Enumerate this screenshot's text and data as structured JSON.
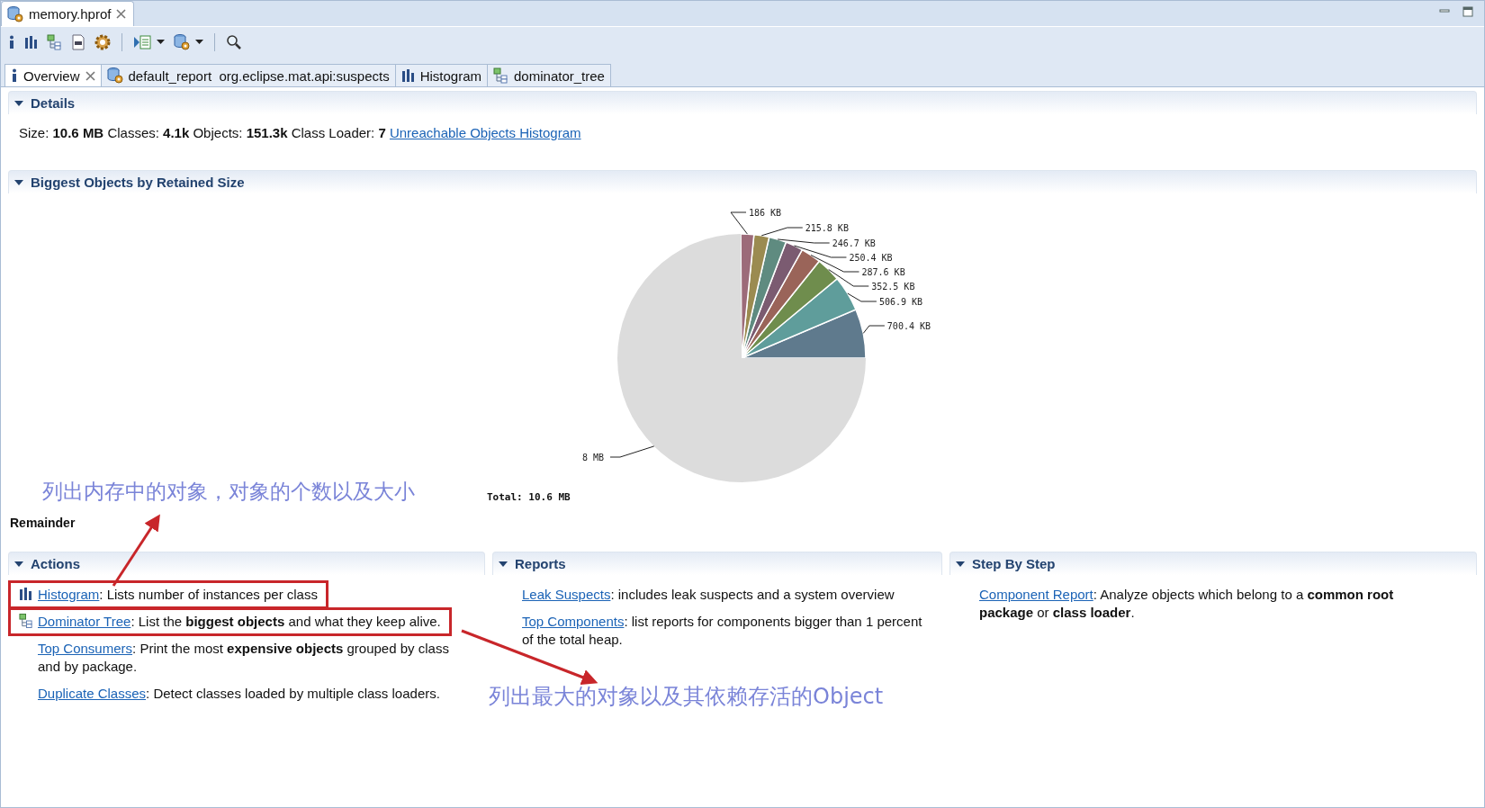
{
  "editor_tab": {
    "title": "memory.hprof",
    "selected": true,
    "closable": true
  },
  "tabs": [
    {
      "kind": "info",
      "label": "Overview",
      "selected": true,
      "closable": true
    },
    {
      "kind": "report",
      "label": "default_report  org.eclipse.mat.api:suspects",
      "selected": false,
      "closable": false
    },
    {
      "kind": "histogram",
      "label": "Histogram",
      "selected": false,
      "closable": false
    },
    {
      "kind": "tree",
      "label": "dominator_tree",
      "selected": false,
      "closable": false
    }
  ],
  "details": {
    "title": "Details",
    "expanded": true,
    "text": "Size: **10.6 MB** Classes: **4.1k** Objects: **151.3k** Class Loader: **7**",
    "link": "Unreachable Objects Histogram"
  },
  "biggest_objects": {
    "title": "Biggest Objects by Retained Size",
    "expanded": true,
    "chart_data": {
      "type": "pie",
      "categories": [
        "700.4 KB",
        "506.9 KB",
        "352.5 KB",
        "287.6 KB",
        "250.4 KB",
        "246.7 KB",
        "215.8 KB",
        "186 KB",
        "8 MB"
      ],
      "values": [
        700.4,
        506.9,
        352.5,
        287.6,
        250.4,
        246.7,
        215.8,
        186,
        8192
      ]
    },
    "total": "Total: 10.6 MB",
    "remainder_label": "Remainder"
  },
  "columns": [
    {
      "title": "Actions",
      "expanded": true,
      "items": [
        {
          "kind": "histogram",
          "highlighted": true,
          "link": "Histogram",
          "text": ": Lists number of instances per class"
        },
        {
          "kind": "tree",
          "highlighted": true,
          "link": "Dominator Tree",
          "text": ": List the **biggest objects** and what they keep alive."
        },
        {
          "kind": "none",
          "highlighted": false,
          "link": "Top Consumers",
          "text": ": Print the most **expensive objects** grouped by class and by package."
        },
        {
          "kind": "none",
          "highlighted": false,
          "link": "Duplicate Classes",
          "text": ": Detect classes loaded by multiple class loaders."
        }
      ]
    },
    {
      "title": "Reports",
      "expanded": true,
      "items": [
        {
          "kind": "none",
          "link": "Leak Suspects",
          "text": ": includes leak suspects and a system overview"
        },
        {
          "kind": "none",
          "link": "Top Components",
          "text": ": list reports for components bigger than 1 percent of the total heap."
        }
      ]
    },
    {
      "title": "Step By Step",
      "expanded": true,
      "items": [
        {
          "kind": "none",
          "link": "Component Report",
          "text": ": Analyze objects which belong to a **common root package** or **class loader**."
        }
      ]
    }
  ],
  "annotations": [
    {
      "text": "列出内存中的对象，对象的个数以及大小"
    },
    {
      "text": "列出最大的对象以及其依赖存活的Object"
    }
  ]
}
